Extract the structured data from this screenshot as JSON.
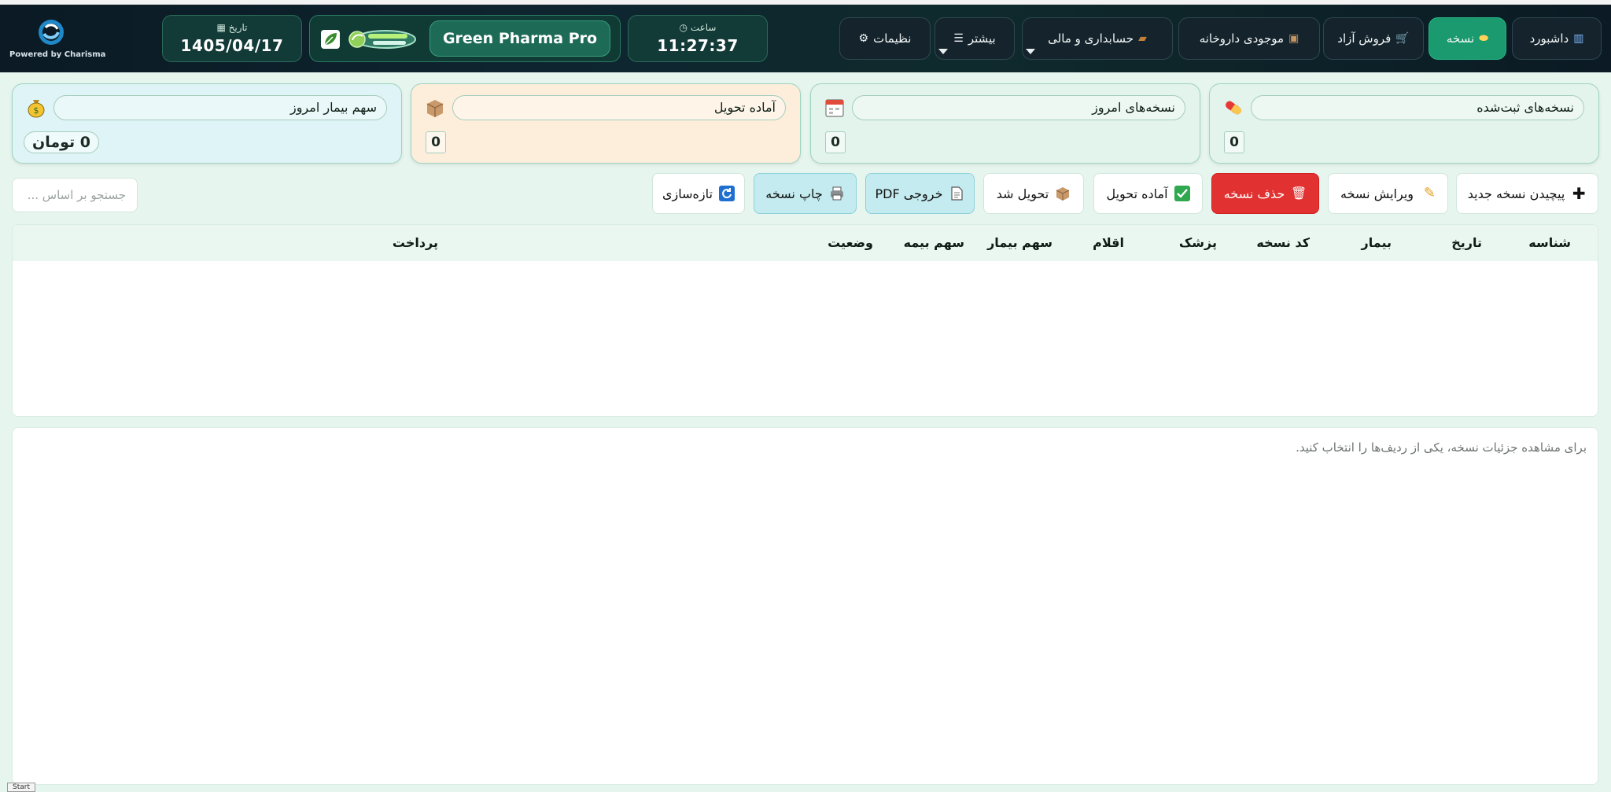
{
  "brand": {
    "powered_by": "Powered by Charisma"
  },
  "header": {
    "date_caption": "تاریخ",
    "date_value": "1405/04/17",
    "app_name": "Green Pharma Pro",
    "time_caption": "ساعت",
    "time_value": "11:27:37"
  },
  "nav": [
    {
      "label": "داشبورد",
      "icon": "chart-icon"
    },
    {
      "label": "نسخه",
      "icon": "pill-icon",
      "active": true
    },
    {
      "label": "فروش آزاد",
      "icon": "cart-icon"
    },
    {
      "label": "موجودی داروخانه",
      "icon": "box-icon"
    },
    {
      "label": "حسابداری و مالی",
      "icon": "briefcase-icon"
    },
    {
      "label": "بیشتر",
      "icon": "menu-icon"
    },
    {
      "label": "نظیمات",
      "icon": "gear-icon"
    }
  ],
  "cards": [
    {
      "label": "نسخه‌های ثبت‌شده",
      "value": "0",
      "color": "#e3f4ec",
      "icon": "pill-icon"
    },
    {
      "label": "نسخه‌های امروز",
      "value": "0",
      "color": "#e3f4ec",
      "icon": "calendar-icon"
    },
    {
      "label": "آماده تحویل",
      "value": "0",
      "color": "#fdeedc",
      "icon": "box-icon"
    },
    {
      "label": "سهم بیمار امروز",
      "value": "0 تومان",
      "color": "#dff4f6",
      "icon": "money-bag-icon"
    }
  ],
  "toolbar": {
    "new": "پیچیدن نسخه جدید",
    "edit": "ویرایش نسخه",
    "delete": "حذف نسخه",
    "ready": "آماده تحویل",
    "delivered": "تحویل شد",
    "pdf": "خروجی PDF",
    "print": "چاپ نسخه",
    "refresh": "تازه‌سازی",
    "search_placeholder": "جستجو بر اساس ..."
  },
  "table": {
    "columns": [
      "شناسه",
      "تاریخ",
      "بیمار",
      "کد نسخه",
      "پزشک",
      "اقلام",
      "سهم بیمار",
      "سهم بیمه",
      "وضعیت",
      "پرداخت"
    ],
    "rows": []
  },
  "details": {
    "empty_message": "برای مشاهده جزئیات نسخه، یکی از ردیف‌ها را انتخاب کنید."
  },
  "taskbar": {
    "start": "Start"
  },
  "colors": {
    "accent": "#1a9a6e",
    "danger": "#e23131",
    "header_bg": "#0b1a24"
  }
}
